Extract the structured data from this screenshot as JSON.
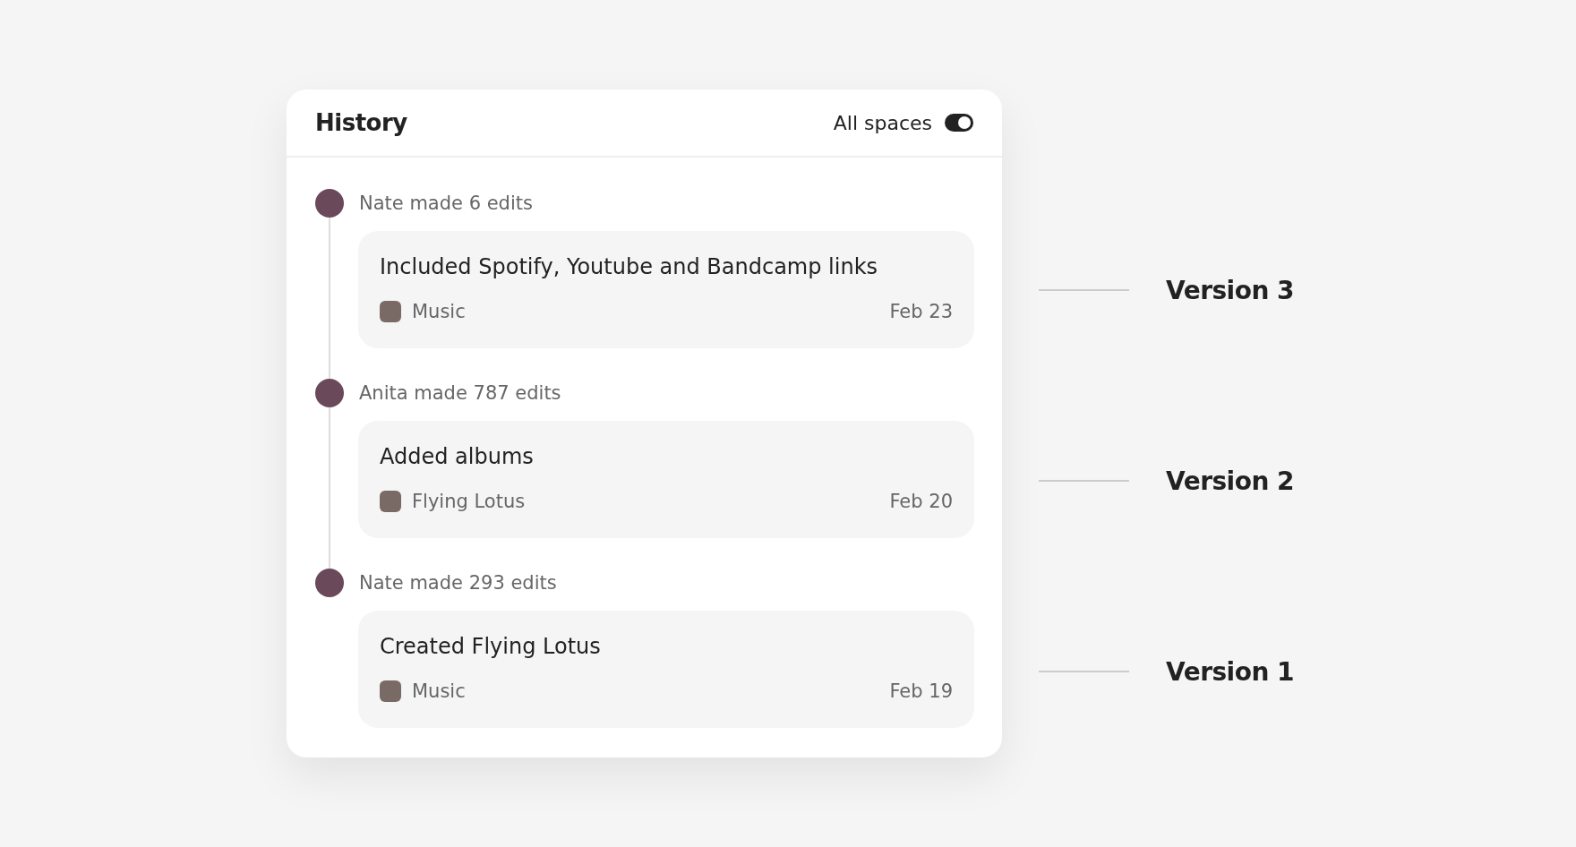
{
  "panel": {
    "title": "History",
    "filter": {
      "label": "All spaces",
      "on": true
    }
  },
  "entries": [
    {
      "summary": "Nate made 6 edits",
      "title": "Included Spotify, Youtube and Bandcamp links",
      "space": "Music",
      "date": "Feb 23"
    },
    {
      "summary": "Anita made 787 edits",
      "title": "Added albums",
      "space": "Flying Lotus",
      "date": "Feb 20"
    },
    {
      "summary": "Nate made 293 edits",
      "title": "Created Flying Lotus",
      "space": "Music",
      "date": "Feb 19"
    }
  ],
  "annotations": [
    "Version 3",
    "Version 2",
    "Version 1"
  ]
}
